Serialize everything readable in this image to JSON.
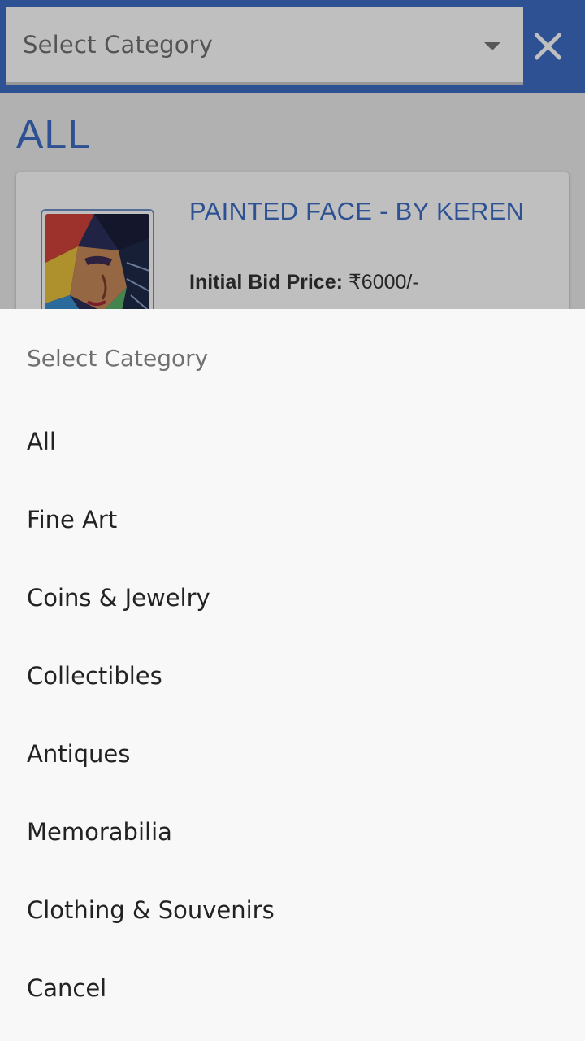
{
  "header": {
    "select_placeholder": "Select Category",
    "dropdown_icon": "caret-down-icon",
    "close_icon": "close-icon"
  },
  "page": {
    "section_title": "ALL"
  },
  "listing": {
    "title": "PAINTED FACE - BY KEREN",
    "bid_label": "Initial Bid Price:",
    "bid_value": "₹6000/-"
  },
  "sheet": {
    "title": "Select Category",
    "options": [
      "All",
      "Fine Art",
      "Coins & Jewelry",
      "Collectibles",
      "Antiques",
      "Memorabilia",
      "Clothing & Souvenirs",
      "Cancel"
    ]
  },
  "colors": {
    "brand": "#3e6dc5",
    "sheet_bg": "#f8f8f8",
    "text": "#222222",
    "muted": "#707070"
  }
}
